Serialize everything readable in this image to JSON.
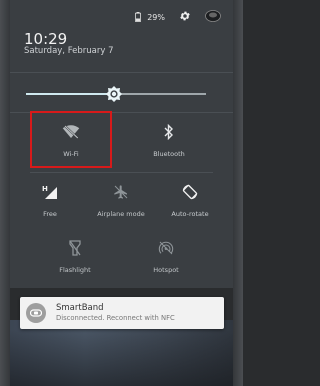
{
  "status": {
    "battery": "29%",
    "battery_icon": "battery-icon",
    "settings_icon": "gear-icon",
    "avatar_icon": "avatar-icon"
  },
  "header": {
    "time": "10:29",
    "date": "Saturday, February 7"
  },
  "brightness": {
    "level": 0.49,
    "icon": "brightness-icon"
  },
  "tiles": [
    {
      "label": "Wi-Fi",
      "icon": "wifi-off-icon",
      "highlighted": true
    },
    {
      "label": "Bluetooth",
      "icon": "bluetooth-icon"
    },
    {
      "label": "Free",
      "icon": "signal-icon"
    },
    {
      "label": "Airplane mode",
      "icon": "airplane-icon"
    },
    {
      "label": "Auto-rotate",
      "icon": "rotate-icon"
    },
    {
      "label": "Flashlight",
      "icon": "flashlight-icon"
    },
    {
      "label": "Hotspot",
      "icon": "hotspot-icon"
    }
  ],
  "notification": {
    "title": "SmartBand",
    "text": "Disconnected. Reconnect with NFC",
    "icon": "smartband-icon"
  },
  "colors": {
    "panel": "#3a3e42",
    "accent": "#cfe9ef",
    "highlight": "#d71a1a"
  }
}
